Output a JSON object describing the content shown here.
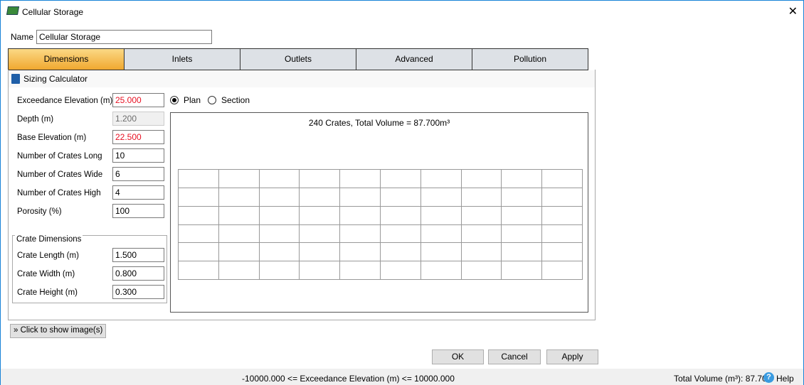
{
  "window": {
    "title": "Cellular Storage",
    "close": "✕"
  },
  "name": {
    "label": "Name",
    "value": "Cellular Storage"
  },
  "tabs": [
    "Dimensions",
    "Inlets",
    "Outlets",
    "Advanced",
    "Pollution"
  ],
  "section": "Sizing Calculator",
  "fields": [
    {
      "label": "Exceedance Elevation (m)",
      "value": "25.000",
      "state": "error"
    },
    {
      "label": "Depth (m)",
      "value": "1.200",
      "state": "disabled"
    },
    {
      "label": "Base Elevation (m)",
      "value": "22.500",
      "state": "error"
    },
    {
      "label": "Number of Crates Long",
      "value": "10",
      "state": "normal"
    },
    {
      "label": "Number of Crates Wide",
      "value": "6",
      "state": "normal"
    },
    {
      "label": "Number of Crates High",
      "value": "4",
      "state": "normal"
    },
    {
      "label": "Porosity (%)",
      "value": "100",
      "state": "normal"
    }
  ],
  "crate": {
    "title": "Crate Dimensions",
    "fields": [
      {
        "label": "Crate Length (m)",
        "value": "1.500"
      },
      {
        "label": "Crate Width (m)",
        "value": "0.800"
      },
      {
        "label": "Crate Height (m)",
        "value": "0.300"
      }
    ]
  },
  "view": {
    "options": [
      "Plan",
      "Section"
    ],
    "selected": "Plan",
    "summary": "240 Crates, Total Volume = 87.700m³",
    "columns": 10,
    "rows": 6
  },
  "show_images": "Click to show image(s)",
  "buttons": {
    "ok": "OK",
    "cancel": "Cancel",
    "apply": "Apply"
  },
  "status": {
    "message": "-10000.000 <= Exceedance Elevation (m) <= 10000.000",
    "total": "Total Volume (m³): 87.700",
    "help": "Help"
  },
  "colors": {
    "error": "#e81123",
    "active_tab": "#f0a830"
  }
}
